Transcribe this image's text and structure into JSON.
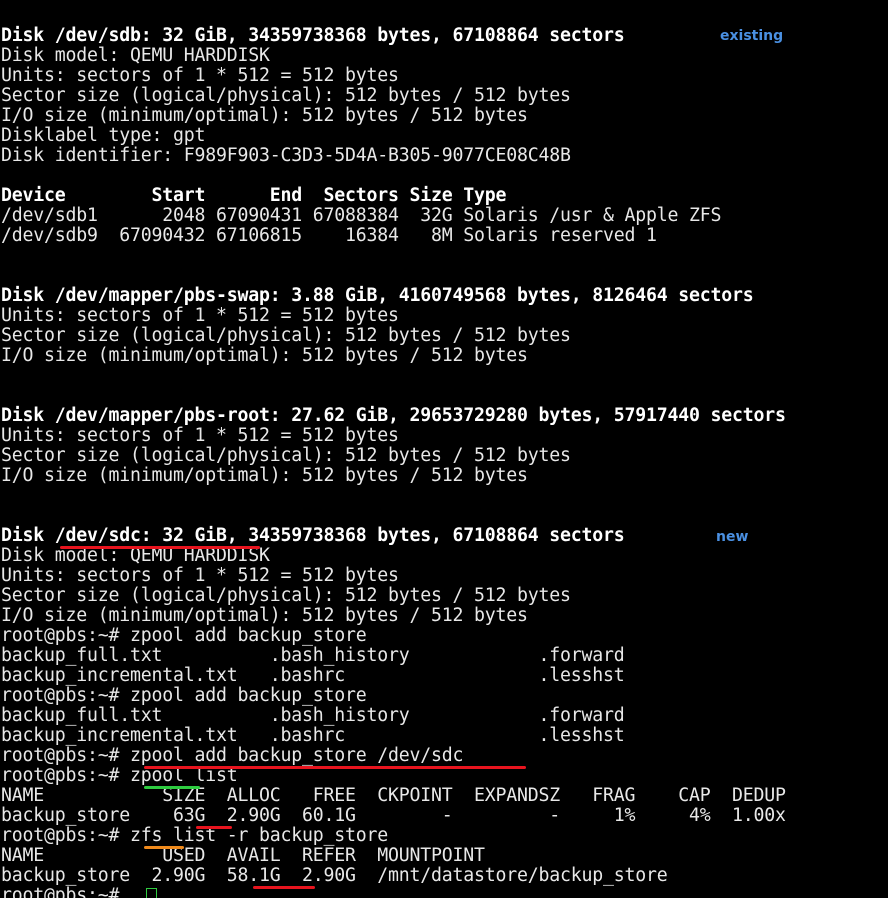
{
  "terminal": {
    "lines": [
      "Disk /dev/sdb: 32 GiB, 34359738368 bytes, 67108864 sectors",
      "Disk model: QEMU HARDDISK",
      "Units: sectors of 1 * 512 = 512 bytes",
      "Sector size (logical/physical): 512 bytes / 512 bytes",
      "I/O size (minimum/optimal): 512 bytes / 512 bytes",
      "Disklabel type: gpt",
      "Disk identifier: F989F903-C3D3-5D4A-B305-9077CE08C48B",
      "",
      "Device        Start      End  Sectors Size Type",
      "/dev/sdb1      2048 67090431 67088384  32G Solaris /usr & Apple ZFS",
      "/dev/sdb9  67090432 67106815    16384   8M Solaris reserved 1",
      "",
      "",
      "Disk /dev/mapper/pbs-swap: 3.88 GiB, 4160749568 bytes, 8126464 sectors",
      "Units: sectors of 1 * 512 = 512 bytes",
      "Sector size (logical/physical): 512 bytes / 512 bytes",
      "I/O size (minimum/optimal): 512 bytes / 512 bytes",
      "",
      "",
      "Disk /dev/mapper/pbs-root: 27.62 GiB, 29653729280 bytes, 57917440 sectors",
      "Units: sectors of 1 * 512 = 512 bytes",
      "Sector size (logical/physical): 512 bytes / 512 bytes",
      "I/O size (minimum/optimal): 512 bytes / 512 bytes",
      "",
      "",
      "Disk /dev/sdc: 32 GiB, 34359738368 bytes, 67108864 sectors",
      "Disk model: QEMU HARDDISK",
      "Units: sectors of 1 * 512 = 512 bytes",
      "Sector size (logical/physical): 512 bytes / 512 bytes",
      "I/O size (minimum/optimal): 512 bytes / 512 bytes",
      "root@pbs:~# zpool add backup_store",
      "backup_full.txt          .bash_history            .forward",
      "backup_incremental.txt   .bashrc                  .lesshst",
      "root@pbs:~# zpool add backup_store",
      "backup_full.txt          .bash_history            .forward",
      "backup_incremental.txt   .bashrc                  .lesshst",
      "root@pbs:~# zpool add backup_store /dev/sdc",
      "root@pbs:~# zpool list",
      "NAME           SIZE  ALLOC   FREE  CKPOINT  EXPANDSZ   FRAG    CAP  DEDUP",
      "backup_store    63G  2.90G  60.1G        -         -     1%     4%  1.00x",
      "root@pbs:~# zfs list -r backup_store",
      "NAME           USED  AVAIL  REFER  MOUNTPOINT",
      "backup_store  2.90G  58.1G  2.90G  /mnt/datastore/backup_store",
      "root@pbs:~# "
    ],
    "annotations": {
      "existing_label": "existing",
      "new_label": "new"
    },
    "colors": {
      "background": "#000000",
      "text": "#e8e8e8",
      "bold_text": "#ffffff",
      "label_existing": "#4a90e2",
      "label_new": "#4a90e2",
      "underline_red": "#e8141e",
      "underline_green": "#2ecc40",
      "underline_orange": "#f08a1c",
      "cursor": "#2ecc40"
    }
  }
}
